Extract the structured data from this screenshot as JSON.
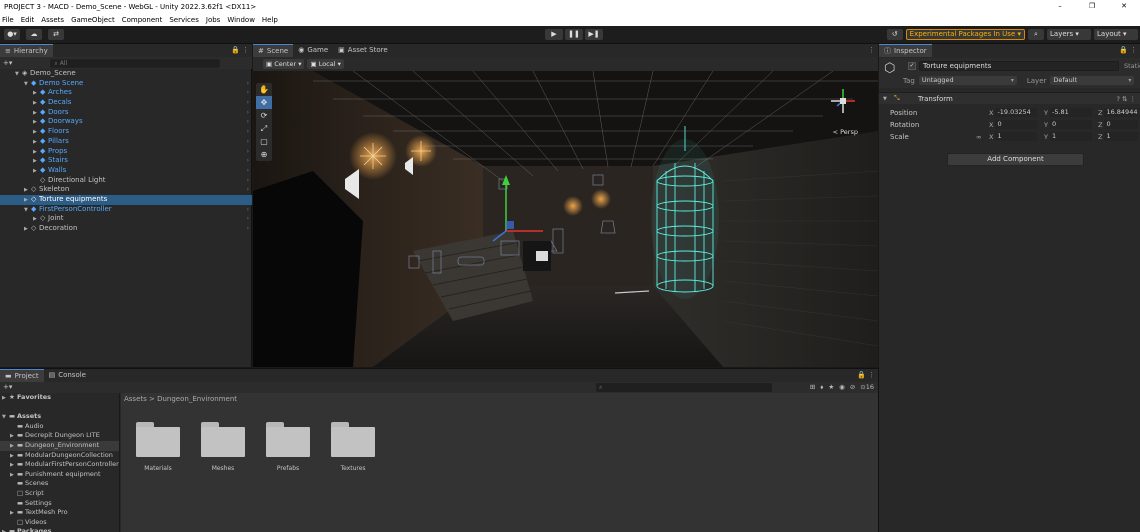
{
  "window": {
    "title": "PROJECT 3 - MACD - Demo_Scene - WebGL - Unity 2022.3.62f1 <DX11>",
    "controls": [
      "–",
      "❐",
      "✕"
    ]
  },
  "menu": [
    "File",
    "Edit",
    "Assets",
    "GameObject",
    "Component",
    "Services",
    "Jobs",
    "Window",
    "Help"
  ],
  "toolbar": {
    "experimental": "Experimental Packages In Use ▾",
    "layers": "Layers",
    "layout": "Layout"
  },
  "hierarchy": {
    "tab": "Hierarchy",
    "search_placeholder": "All",
    "items": [
      {
        "label": "Demo_Scene",
        "indent": 1,
        "arrow": "▼",
        "icon": "◈",
        "blue": false
      },
      {
        "label": "Demo Scene",
        "indent": 2,
        "arrow": "▼",
        "icon": "◆",
        "blue": true
      },
      {
        "label": "Arches",
        "indent": 3,
        "arrow": "▶",
        "icon": "◆",
        "blue": true
      },
      {
        "label": "Decals",
        "indent": 3,
        "arrow": "▶",
        "icon": "◆",
        "blue": true
      },
      {
        "label": "Doors",
        "indent": 3,
        "arrow": "▶",
        "icon": "◆",
        "blue": true
      },
      {
        "label": "Doorways",
        "indent": 3,
        "arrow": "▶",
        "icon": "◆",
        "blue": true
      },
      {
        "label": "Floors",
        "indent": 3,
        "arrow": "▶",
        "icon": "◆",
        "blue": true
      },
      {
        "label": "Pillars",
        "indent": 3,
        "arrow": "▶",
        "icon": "◆",
        "blue": true
      },
      {
        "label": "Props",
        "indent": 3,
        "arrow": "▶",
        "icon": "◆",
        "blue": true
      },
      {
        "label": "Stairs",
        "indent": 3,
        "arrow": "▶",
        "icon": "◆",
        "blue": true
      },
      {
        "label": "Walls",
        "indent": 3,
        "arrow": "▶",
        "icon": "◆",
        "blue": true
      },
      {
        "label": "Directional Light",
        "indent": 3,
        "arrow": "",
        "icon": "◇",
        "blue": false
      },
      {
        "label": "Skeleton",
        "indent": 2,
        "arrow": "▶",
        "icon": "◇",
        "blue": false
      },
      {
        "label": "Torture equipments",
        "indent": 2,
        "arrow": "▶",
        "icon": "◇",
        "blue": false,
        "selected": true
      },
      {
        "label": "FirstPersonController",
        "indent": 2,
        "arrow": "▼",
        "icon": "◆",
        "blue": true
      },
      {
        "label": "Joint",
        "indent": 3,
        "arrow": "▶",
        "icon": "◇",
        "blue": false
      },
      {
        "label": "Decoration",
        "indent": 2,
        "arrow": "▶",
        "icon": "◇",
        "blue": false
      }
    ]
  },
  "scene": {
    "tabs": [
      "Scene",
      "Game",
      "Asset Store"
    ],
    "pivot": "Center",
    "space": "Local",
    "persp": "< Persp",
    "tools": [
      "✋",
      "✥",
      "⟳",
      "⤢",
      "▢",
      "⊕"
    ]
  },
  "inspector": {
    "tab": "Inspector",
    "object_name": "Torture equipments",
    "static_label": "Static",
    "tag_label": "Tag",
    "tag_value": "Untagged",
    "layer_label": "Layer",
    "layer_value": "Default",
    "component": "Transform",
    "position": {
      "label": "Position",
      "x": "-19.03254",
      "y": "-5.81",
      "z": "16.84944"
    },
    "rotation": {
      "label": "Rotation",
      "x": "0",
      "y": "0",
      "z": "0"
    },
    "scale": {
      "label": "Scale",
      "x": "1",
      "y": "1",
      "z": "1"
    },
    "add_component": "Add Component"
  },
  "project": {
    "tabs": [
      "Project",
      "Console"
    ],
    "search_placeholder": "",
    "badge": "16",
    "breadcrumb": "Assets > Dungeon_Environment",
    "tree": [
      {
        "label": "Favorites",
        "indent": 0,
        "arrow": "▶",
        "icon": "★",
        "bold": true
      },
      {
        "label": "",
        "indent": 0,
        "arrow": "",
        "icon": ""
      },
      {
        "label": "Assets",
        "indent": 0,
        "arrow": "▼",
        "icon": "▬",
        "bold": true
      },
      {
        "label": "Audio",
        "indent": 1,
        "arrow": "",
        "icon": "▬"
      },
      {
        "label": "Decrepit Dungeon LITE",
        "indent": 1,
        "arrow": "▶",
        "icon": "▬"
      },
      {
        "label": "Dungeon_Environment",
        "indent": 1,
        "arrow": "▶",
        "icon": "▬",
        "selected": true
      },
      {
        "label": "ModularDungeonCollection",
        "indent": 1,
        "arrow": "▶",
        "icon": "▬"
      },
      {
        "label": "ModularFirstPersonController",
        "indent": 1,
        "arrow": "▶",
        "icon": "▬"
      },
      {
        "label": "Punishment equipment",
        "indent": 1,
        "arrow": "▶",
        "icon": "▬"
      },
      {
        "label": "Scenes",
        "indent": 1,
        "arrow": "",
        "icon": "▬"
      },
      {
        "label": "Script",
        "indent": 1,
        "arrow": "",
        "icon": "□"
      },
      {
        "label": "Settings",
        "indent": 1,
        "arrow": "",
        "icon": "▬"
      },
      {
        "label": "TextMesh Pro",
        "indent": 1,
        "arrow": "▶",
        "icon": "▬"
      },
      {
        "label": "Videos",
        "indent": 1,
        "arrow": "",
        "icon": "□"
      },
      {
        "label": "Packages",
        "indent": 0,
        "arrow": "▶",
        "icon": "▬",
        "bold": true
      }
    ],
    "folders": [
      "Materials",
      "Meshes",
      "Prefabs",
      "Textures"
    ]
  }
}
